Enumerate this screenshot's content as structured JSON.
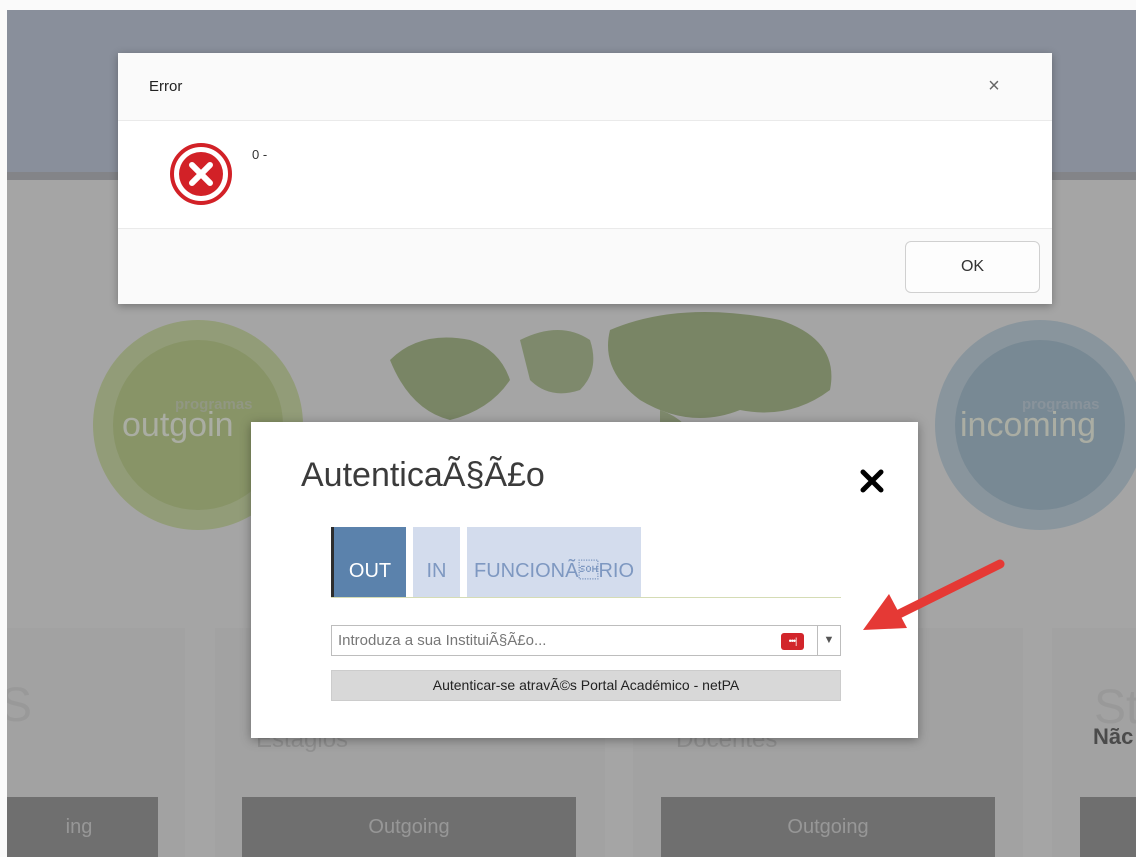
{
  "background": {
    "outgoing_circle": {
      "small": "programas",
      "big": "outgoin"
    },
    "incoming_circle": {
      "small": "programas",
      "big": "incoming"
    },
    "cards": [
      {
        "title": "Estágios",
        "button": "Outgoing"
      },
      {
        "title": "Docentes",
        "button": "Outgoing"
      }
    ],
    "left_card": {
      "big": "S",
      "button": "ing"
    },
    "right_card": {
      "big": "St",
      "subtitle": "Nãc"
    }
  },
  "auth_dialog": {
    "title": "AutenticaÃ§Ã£o",
    "close_icon": "close-x-icon",
    "tabs": [
      {
        "label": "OUT",
        "active": true
      },
      {
        "label": "IN",
        "active": false
      },
      {
        "label": "FUNCIONÃ\u0001RIO",
        "active": false
      }
    ],
    "institution_placeholder": "Introduza a sua InstituiÃ§Ã£o...",
    "password_manager_badge": "•••|",
    "netpa_button": "Autenticar-se atravÃ©s Portal Académico - netPA"
  },
  "error_dialog": {
    "title": "Error",
    "close_label": "×",
    "message": "0 -",
    "icon": "error-x-circle-icon",
    "ok_button": "OK"
  },
  "colors": {
    "tab_active": "#5b82ac",
    "tab_inactive": "#d3dced",
    "error_red": "#d22127",
    "arrow_red": "#e53935"
  }
}
